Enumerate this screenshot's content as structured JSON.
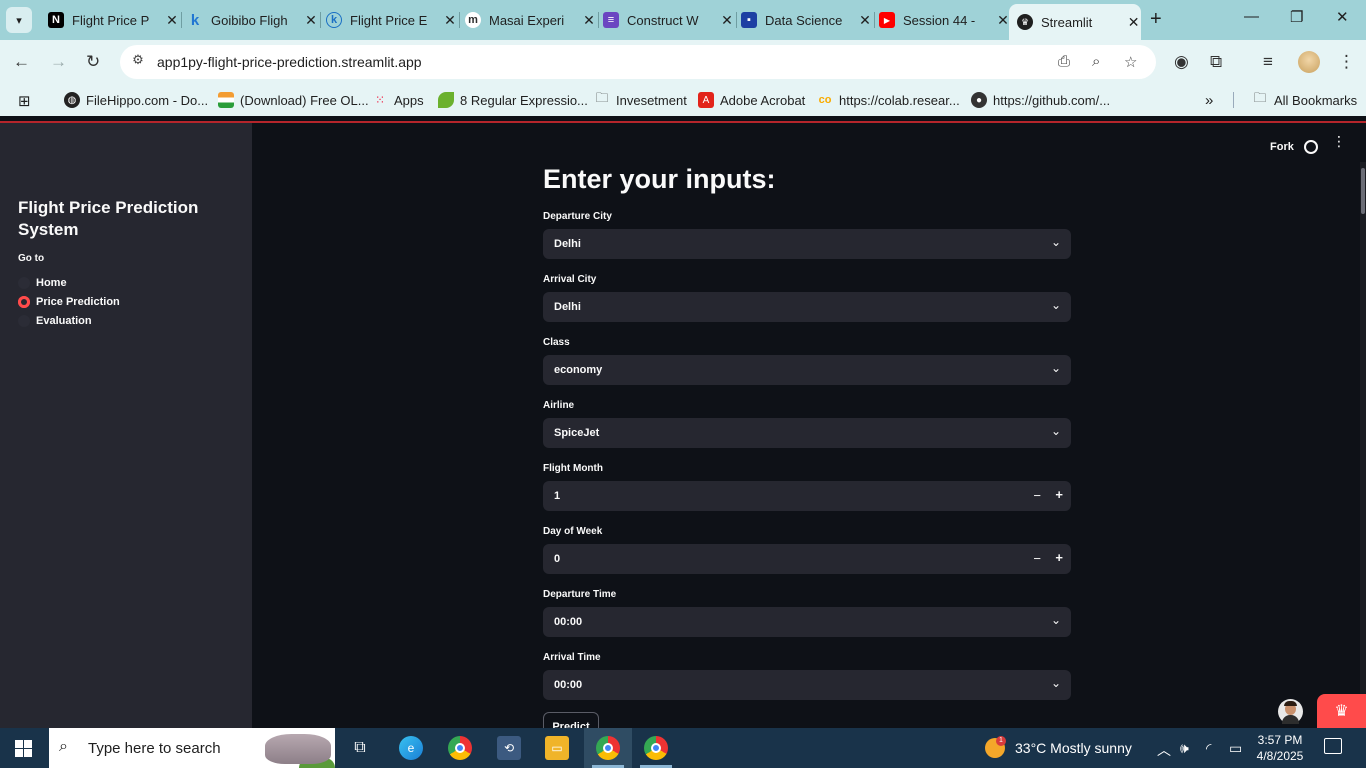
{
  "browser": {
    "tabs": [
      {
        "title": "Flight Price P",
        "fav": "N",
        "favColor": "#000000"
      },
      {
        "title": "Goibibo Fligh",
        "fav": "k",
        "favColor": "#2176d2"
      },
      {
        "title": "Flight Price E",
        "fav": "k",
        "favColor": "#1a6fc4"
      },
      {
        "title": "Masai Experi",
        "fav": "m",
        "favColor": "#2d2d2d"
      },
      {
        "title": "Construct W",
        "fav": "≡",
        "favColor": "#6b46c1"
      },
      {
        "title": "Data Science",
        "fav": "▪",
        "favColor": "#1d3fa3"
      },
      {
        "title": "Session 44 -",
        "fav": "▶",
        "favColor": "#ff0000"
      },
      {
        "title": "Streamlit",
        "fav": "♛",
        "favColor": "#1f1f1f"
      }
    ],
    "url": "app1py-flight-price-prediction.streamlit.app",
    "bookmarks": [
      {
        "label": "FileHippo.com - Do...",
        "icon": "globe-icon"
      },
      {
        "label": "(Download) Free OL...",
        "icon": "india-flag-icon"
      },
      {
        "label": "Apps",
        "icon": "apps-grid-icon"
      },
      {
        "label": "8 Regular Expressio...",
        "icon": "leaf-icon"
      },
      {
        "label": "Invesetment",
        "icon": "folder-icon"
      },
      {
        "label": "Adobe Acrobat",
        "icon": "acrobat-icon"
      },
      {
        "label": "https://colab.resear...",
        "icon": "colab-icon"
      },
      {
        "label": "https://github.com/...",
        "icon": "github-icon"
      }
    ],
    "all_bookmarks": "All Bookmarks",
    "more_chevron": "»"
  },
  "sidebar": {
    "title": "Flight Price Prediction System",
    "goto_label": "Go to",
    "options": [
      "Home",
      "Price Prediction",
      "Evaluation"
    ],
    "selected": "Price Prediction"
  },
  "header": {
    "fork_label": "Fork"
  },
  "form": {
    "heading": "Enter your inputs:",
    "departure_city": {
      "label": "Departure City",
      "value": "Delhi"
    },
    "arrival_city": {
      "label": "Arrival City",
      "value": "Delhi"
    },
    "class": {
      "label": "Class",
      "value": "economy"
    },
    "airline": {
      "label": "Airline",
      "value": "SpiceJet"
    },
    "flight_month": {
      "label": "Flight Month",
      "value": "1"
    },
    "day_of_week": {
      "label": "Day of Week",
      "value": "0"
    },
    "departure_time": {
      "label": "Departure Time",
      "value": "00:00"
    },
    "arrival_time": {
      "label": "Arrival Time",
      "value": "00:00"
    },
    "predict_label": "Predict"
  },
  "taskbar": {
    "search_placeholder": "Type here to search",
    "weather": "33°C  Mostly sunny",
    "weather_badge": "1",
    "time": "3:57 PM",
    "date": "4/8/2025"
  },
  "colors": {
    "accent": "#ff4b4b",
    "background": "#0e1117",
    "sidebar": "#262730",
    "chrome": "#9fd2d7"
  }
}
